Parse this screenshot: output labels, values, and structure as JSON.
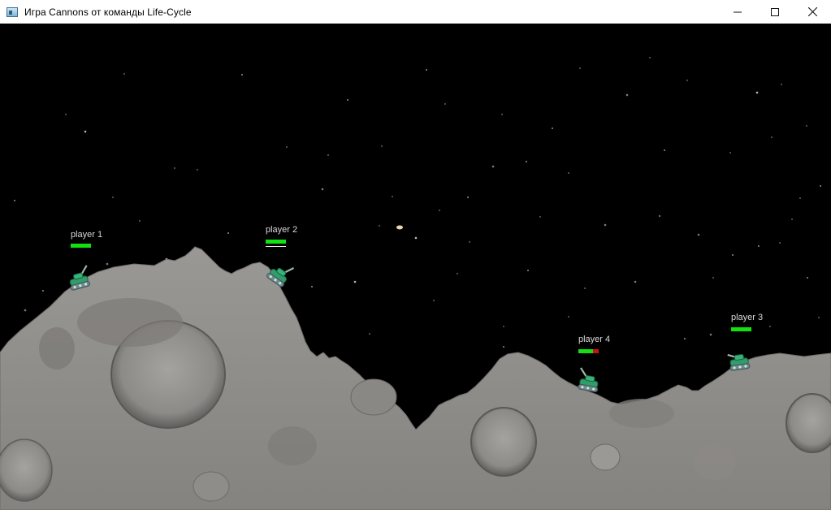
{
  "window": {
    "title": "Игра Cannons от команды Life-Cycle",
    "icon": "window-app-icon",
    "controls": [
      "minimize-icon",
      "maximize-icon",
      "close-icon"
    ]
  },
  "scene": {
    "background_color": "#000000",
    "terrain_color": "#8f8d8a",
    "health_color": "#12e012",
    "damage_color": "#c81414"
  },
  "players": [
    {
      "label": "player 1",
      "health": 1.0
    },
    {
      "label": "player 2",
      "health": 1.0
    },
    {
      "label": "player 3",
      "health": 1.0
    },
    {
      "label": "player 4",
      "health": 0.7
    }
  ]
}
